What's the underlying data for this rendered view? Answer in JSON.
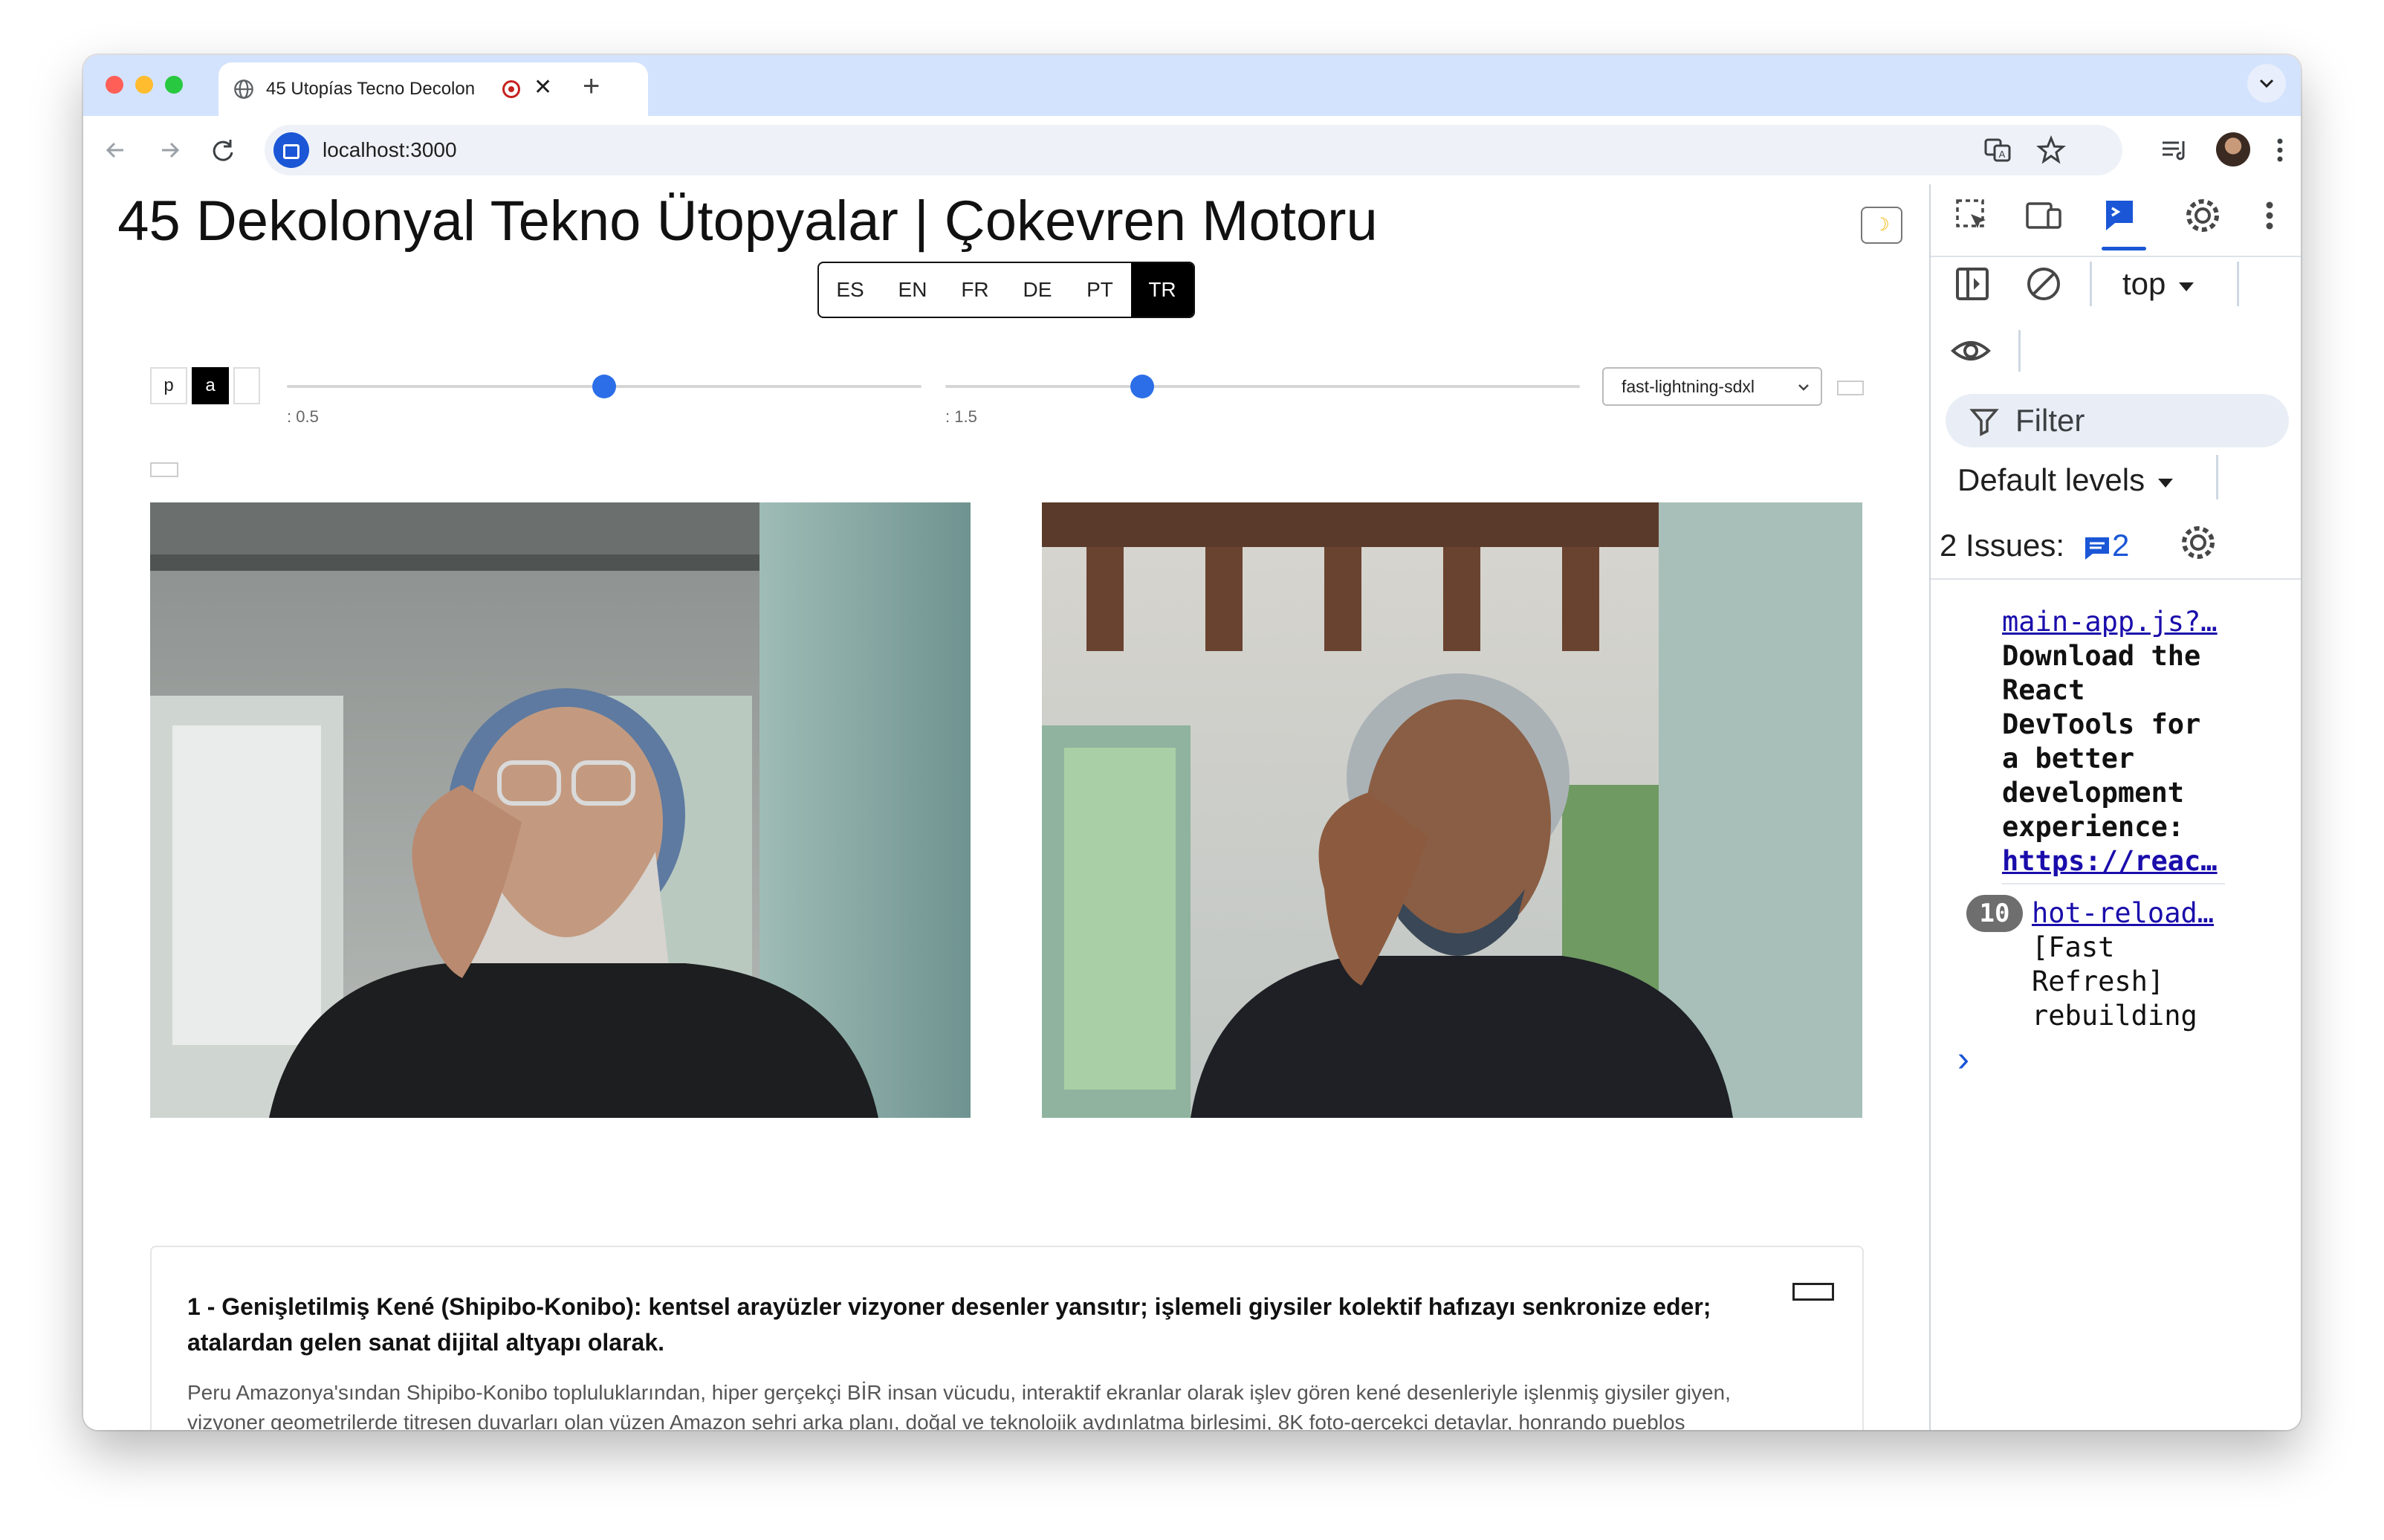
{
  "browser": {
    "tab_title": "45 Utopías Tecno Decolon",
    "tab_close": "✕",
    "new_tab": "+",
    "url": "localhost:3000",
    "traffic_lights": [
      "#ff5f57",
      "#febc2e",
      "#28c840"
    ]
  },
  "app": {
    "title": "45 Dekolonyal Tekno Ütopyalar | Çokevren Motoru",
    "theme_toggle_icon": "☽",
    "languages": [
      "ES",
      "EN",
      "FR",
      "DE",
      "PT",
      "TR"
    ],
    "active_language": "TR",
    "mode_buttons": [
      "p",
      "a",
      ""
    ],
    "sliders": [
      {
        "label": ": 0.5",
        "value_fraction": 0.5
      },
      {
        "label": ": 1.5",
        "value_fraction": 0.31
      }
    ],
    "model_select": {
      "value": "fast-lightning-sdxl"
    },
    "cards": [
      {
        "heading": "1 - Genişletilmiş Kené (Shipibo-Konibo): kentsel arayüzler vizyoner desenler yansıtır; işlemeli giysiler kolektif hafızayı senkronize eder; atalardan gelen sanat dijital altyapı olarak.",
        "description": "Peru Amazonya'sından Shipibo-Konibo topluluklarından, hiper gerçekçi BİR insan vücudu, interaktif ekranlar olarak işlev gören kené desenleriyle işlenmiş giysiler giyen, vizyoner geometrilerde titreşen duvarları olan yüzen Amazon şehri arka planı, doğal ve teknolojik aydınlatma birleşimi, 8K foto-gerçekçi detaylar, honrando pueblos originarios"
      }
    ]
  },
  "devtools": {
    "context": "top",
    "filter_placeholder": "Filter",
    "levels": "Default levels",
    "issues_label": "2 Issues:",
    "issues_count": "2",
    "messages": [
      {
        "source": "main-app.js?…",
        "text_lines": [
          "Download the",
          "React",
          "DevTools for",
          "a better",
          "development",
          "experience:"
        ],
        "link": "https://reac…"
      },
      {
        "count": "10",
        "source": "hot-reload…",
        "text_lines": [
          "[Fast",
          "Refresh]",
          "rebuilding"
        ]
      }
    ],
    "prompt": "›"
  }
}
